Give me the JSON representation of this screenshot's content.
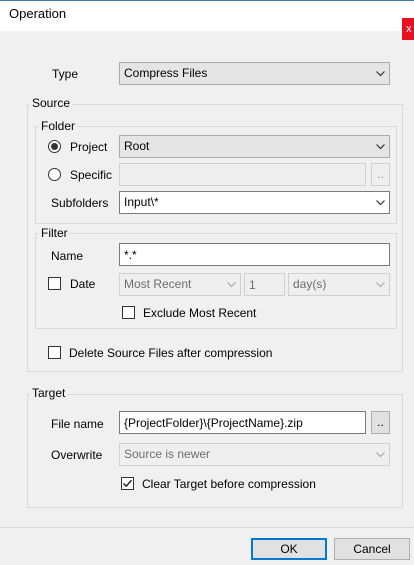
{
  "window": {
    "title": "Operation",
    "close_glyph": "x"
  },
  "type": {
    "label": "Type",
    "value": "Compress Files"
  },
  "source": {
    "legend": "Source",
    "folder": {
      "legend": "Folder",
      "project_label": "Project",
      "project_value": "Root",
      "specific_label": "Specific",
      "specific_value": "",
      "browse_label": "..",
      "subfolders_label": "Subfolders",
      "subfolders_value": "Input\\*"
    },
    "filter": {
      "legend": "Filter",
      "name_label": "Name",
      "name_value": "*.*",
      "date_label": "Date",
      "date_mode": "Most Recent",
      "date_amount": "1",
      "date_unit": "day(s)",
      "exclude_label": "Exclude Most Recent"
    },
    "delete_label": "Delete Source Files after compression"
  },
  "target": {
    "legend": "Target",
    "file_name_label": "File name",
    "file_name_value": "{ProjectFolder}\\{ProjectName}.zip",
    "browse_label": "..",
    "overwrite_label": "Overwrite",
    "overwrite_value": "Source is newer",
    "clear_label": "Clear Target before compression"
  },
  "buttons": {
    "ok": "OK",
    "cancel": "Cancel"
  },
  "state": {
    "folder_mode": "project",
    "date_checked": false,
    "exclude_checked": false,
    "delete_checked": false,
    "clear_checked": true
  },
  "colors": {
    "close": "#e81123",
    "accent": "#0078d7",
    "window_bg": "#f0f0f0"
  }
}
